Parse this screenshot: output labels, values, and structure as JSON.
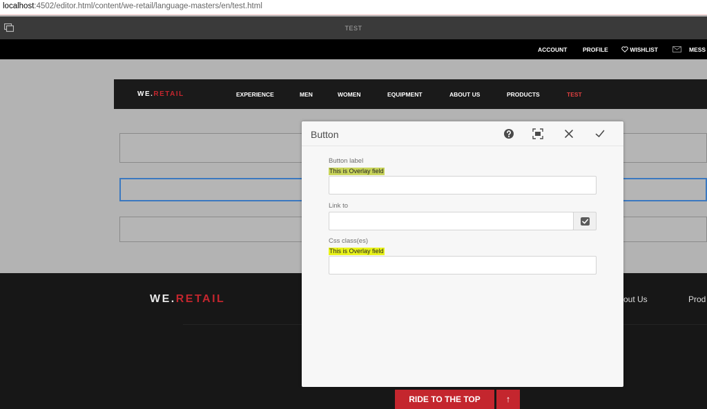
{
  "browser": {
    "url_host": "localhost",
    "url_path": ":4502/editor.html/content/we-retail/language-masters/en/test.html"
  },
  "editor": {
    "page_title": "TEST",
    "toggle_icon": "sidepanel-toggle-icon"
  },
  "userbar": {
    "account": "ACCOUNT",
    "profile": "PROFILE",
    "wishlist": "WISHLIST",
    "messages": "MESS",
    "heart_icon": "heart-icon",
    "mail_icon": "mail-icon"
  },
  "nav": {
    "logo_we": "WE.",
    "logo_retail": "RETAIL",
    "items": [
      "EXPERIENCE",
      "MEN",
      "WOMEN",
      "EQUIPMENT",
      "ABOUT US",
      "PRODUCTS",
      "TEST"
    ],
    "active_color": "#e04040"
  },
  "footer": {
    "logo_we": "WE.",
    "logo_retail": "RETAIL",
    "link_about": "out Us",
    "link_products": "Prod",
    "ride_label": "RIDE TO THE TOP",
    "ride_arrow": "↑",
    "brand_color": "#c4262e"
  },
  "dialog": {
    "title": "Button",
    "help_icon": "help-icon",
    "fullscreen_icon": "fullscreen-icon",
    "close_icon": "close-icon",
    "done_icon": "check-icon",
    "fields": {
      "button_label": {
        "label": "Button label",
        "overlay": "This is Overlay field",
        "value": ""
      },
      "link_to": {
        "label": "Link to",
        "value": ""
      },
      "css_class": {
        "label": "Css class(es)",
        "overlay": "This is Overlay field",
        "value": ""
      }
    },
    "highlight_color": "#e8f21a"
  }
}
